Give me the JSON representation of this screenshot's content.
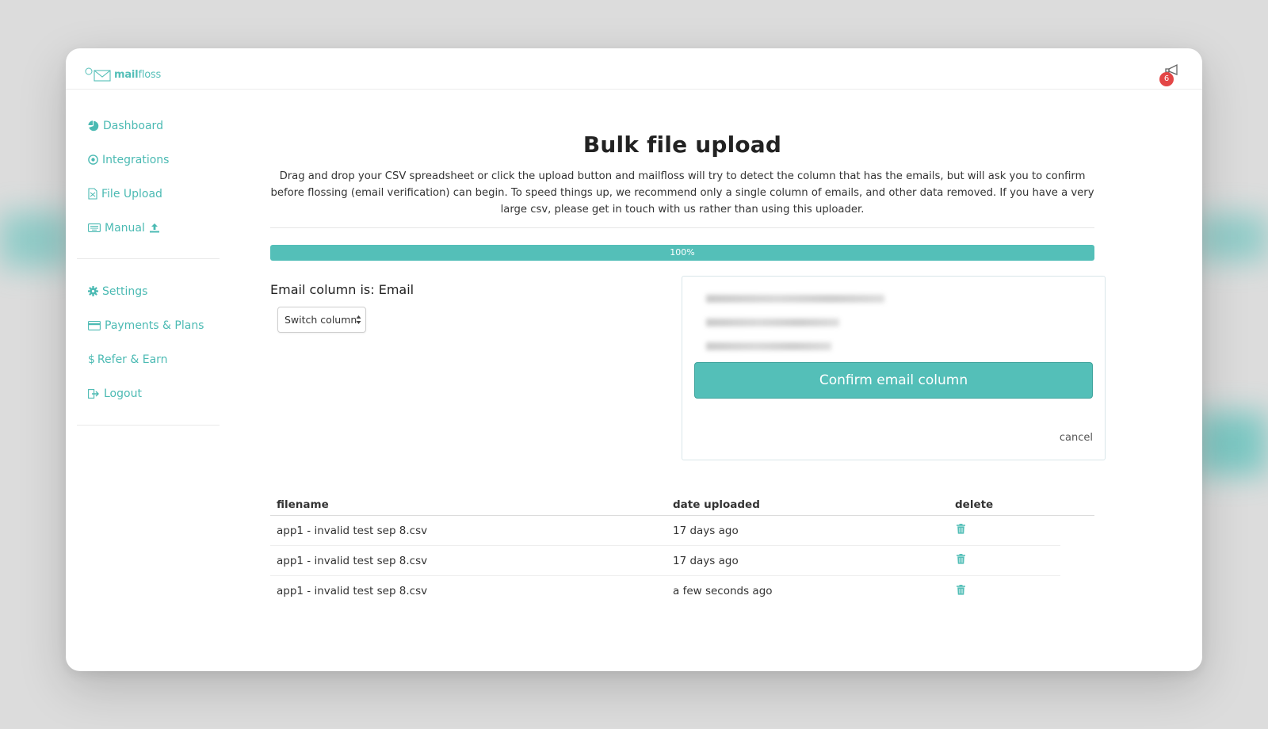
{
  "app": {
    "logo_text": "mailfloss",
    "logo_bold": "mail",
    "logo_light": "floss",
    "notification_count": "6"
  },
  "colors": {
    "accent": "#54bfb8",
    "badge": "#e34646"
  },
  "sidebar": {
    "items": [
      {
        "label": "Dashboard",
        "icon": "pie-chart-icon"
      },
      {
        "label": "Integrations",
        "icon": "target-icon"
      },
      {
        "label": "File Upload",
        "icon": "file-icon"
      },
      {
        "label": "Manual",
        "icon": "keyboard-icon"
      }
    ],
    "items2": [
      {
        "label": "Settings",
        "icon": "gear-icon"
      },
      {
        "label": "Payments & Plans",
        "icon": "credit-card-icon"
      },
      {
        "label": "Refer & Earn",
        "icon": "dollar-icon"
      },
      {
        "label": "Logout",
        "icon": "logout-icon"
      }
    ]
  },
  "page": {
    "title": "Bulk file upload",
    "description": "Drag and drop your CSV spreadsheet or click the upload button and mailfloss will try to detect the column that has the emails, but will ask you to confirm before flossing (email verification) can begin. To speed things up, we recommend only a single column of emails, and other data removed. If you have a very large csv, please get in touch with us rather than using this uploader.",
    "progress_label": "100%",
    "progress_value": 100,
    "column_info": "Email column is: Email",
    "switch_label": "Switch column"
  },
  "preview": {
    "confirm_label": "Confirm email column",
    "cancel_label": "cancel"
  },
  "table": {
    "headers": {
      "filename": "filename",
      "date": "date uploaded",
      "delete": "delete"
    },
    "rows": [
      {
        "filename": "app1 - invalid test sep 8.csv",
        "date": "17 days ago"
      },
      {
        "filename": "app1 - invalid test sep 8.csv",
        "date": "17 days ago"
      },
      {
        "filename": "app1 - invalid test sep 8.csv",
        "date": "a few seconds ago"
      }
    ]
  }
}
